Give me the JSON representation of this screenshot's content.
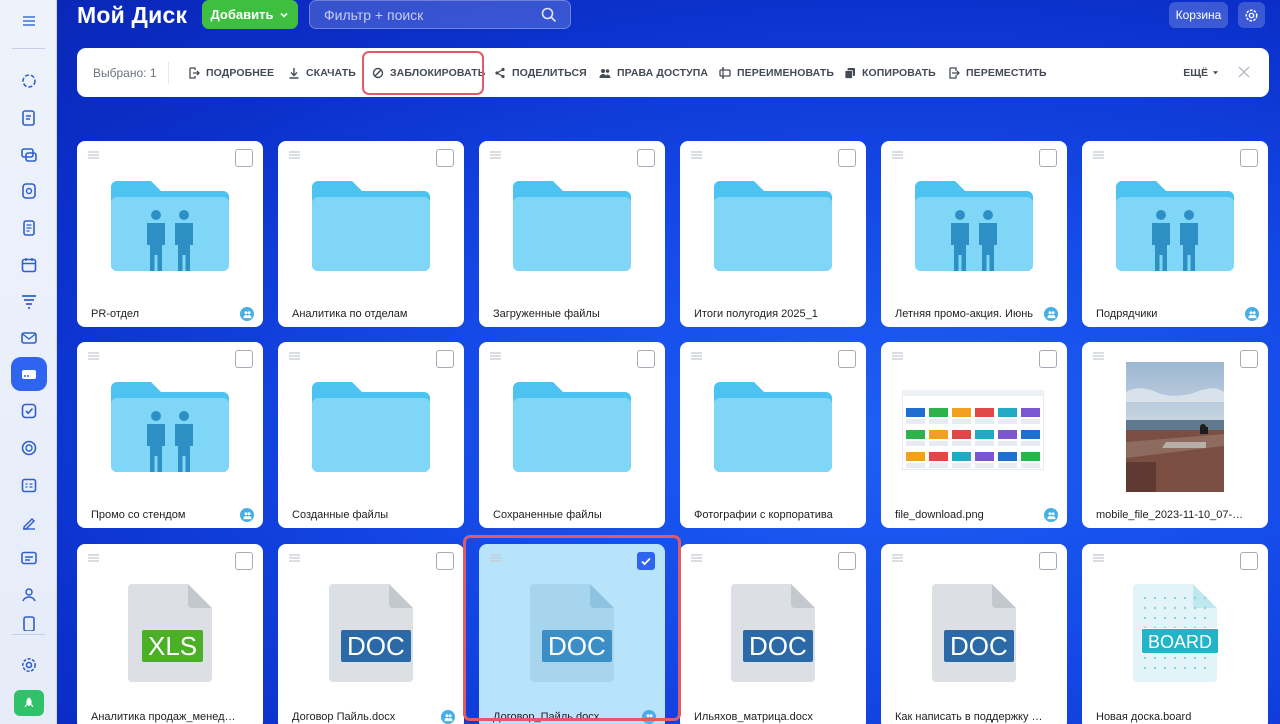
{
  "header": {
    "title": "Мой Диск",
    "add_label": "Добавить",
    "search_placeholder": "Фильтр + поиск",
    "trash_label": "Корзина"
  },
  "toolbar": {
    "selected_text": "Выбрано: 1",
    "actions": [
      {
        "label": "ПОДРОБНЕЕ",
        "icon": "details-icon"
      },
      {
        "label": "СКАЧАТЬ",
        "icon": "download-icon"
      },
      {
        "label": "ЗАБЛОКИРОВАТЬ",
        "icon": "lock-icon"
      },
      {
        "label": "ПОДЕЛИТЬСЯ",
        "icon": "share-icon"
      },
      {
        "label": "ПРАВА ДОСТУПА",
        "icon": "users-icon"
      },
      {
        "label": "ПЕРЕИМЕНОВАТЬ",
        "icon": "rename-icon"
      },
      {
        "label": "КОПИРОВАТЬ",
        "icon": "copy-icon"
      },
      {
        "label": "ПЕРЕМЕСТИТЬ",
        "icon": "move-icon"
      }
    ],
    "more_label": "ЕЩЁ"
  },
  "items": [
    {
      "name": "PR-отдел",
      "type": "folder-shared",
      "shared": true
    },
    {
      "name": "Аналитика по отделам",
      "type": "folder",
      "shared": false
    },
    {
      "name": "Загруженные файлы",
      "type": "folder",
      "shared": false
    },
    {
      "name": "Итоги полугодия 2025_1",
      "type": "folder",
      "shared": false
    },
    {
      "name": "Летняя промо-акция. Июнь",
      "type": "folder-shared",
      "shared": true
    },
    {
      "name": "Подрядчики",
      "type": "folder-shared",
      "shared": true
    },
    {
      "name": "Промо со стендом",
      "type": "folder-shared",
      "shared": true
    },
    {
      "name": "Созданные файлы",
      "type": "folder",
      "shared": false
    },
    {
      "name": "Сохраненные файлы",
      "type": "folder",
      "shared": false
    },
    {
      "name": "Фотографии с корпоратива",
      "type": "folder",
      "shared": false
    },
    {
      "name": "file_download.png",
      "type": "image-screenshot",
      "shared": true
    },
    {
      "name": "mobile_file_2023-11-10_07-30-4...",
      "type": "image-photo",
      "shared": false
    },
    {
      "name": "Аналитика продаж_менеджер...",
      "type": "xls",
      "label": "XLS",
      "shared": false
    },
    {
      "name": "Договор Пайль.docx",
      "type": "doc",
      "label": "DOC",
      "shared": true
    },
    {
      "name": "Договор_Пайль.docx",
      "type": "doc",
      "label": "DOC",
      "shared": true,
      "selected": true
    },
    {
      "name": "Ильяхов_матрица.docx",
      "type": "doc",
      "label": "DOC",
      "shared": false
    },
    {
      "name": "Как написать в поддержку Б24...",
      "type": "doc",
      "label": "DOC",
      "shared": false
    },
    {
      "name": "Новая доска.board",
      "type": "board",
      "label": "BOARD",
      "shared": false
    }
  ],
  "colors": {
    "accent": "#2f64f1",
    "add_button": "#3fbf3f",
    "folder": "#7fd6f7",
    "folder_tab": "#4cc3f0",
    "doc_blue": "#2b6aa6",
    "xls_green": "#4caf28",
    "board_teal": "#22b5c9",
    "highlight": "#e15b66"
  }
}
